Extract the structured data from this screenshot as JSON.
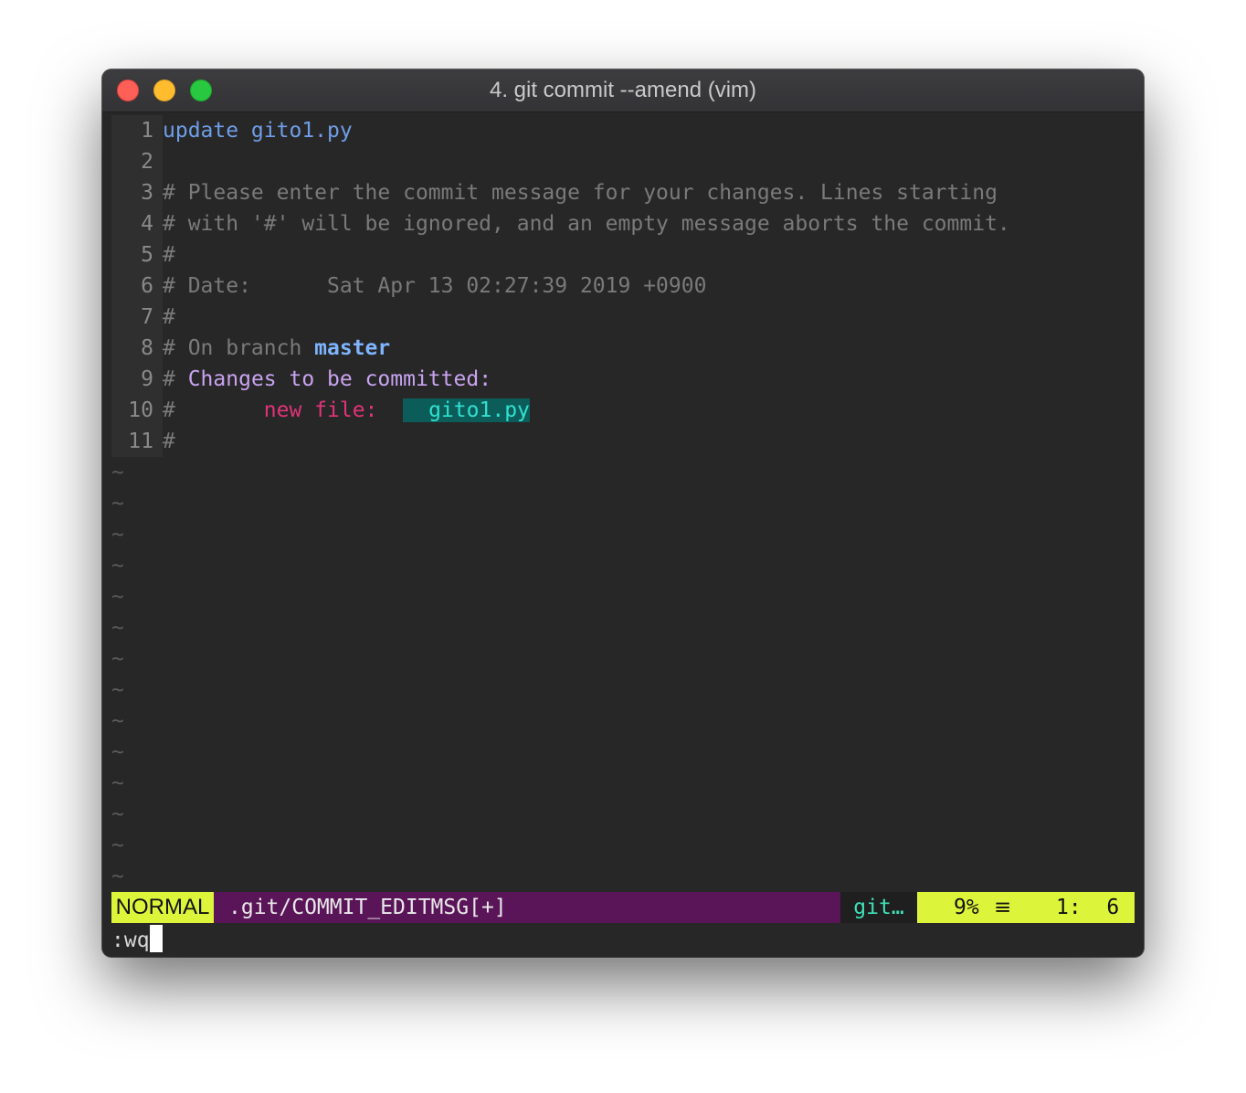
{
  "window": {
    "title": "4. git commit --amend (vim)"
  },
  "editor": {
    "lines": [
      {
        "num": "1",
        "text": "update gito1.py"
      },
      {
        "num": "2",
        "text": ""
      },
      {
        "num": "3",
        "text": "# Please enter the commit message for your changes. Lines starting"
      },
      {
        "num": "4",
        "text": "# with '#' will be ignored, and an empty message aborts the commit."
      },
      {
        "num": "5",
        "text": "#"
      },
      {
        "num": "6",
        "text": "# Date:      Sat Apr 13 02:27:39 2019 +0900"
      },
      {
        "num": "7",
        "text": "#"
      },
      {
        "num": "8",
        "prefix": "# On branch ",
        "branch": "master"
      },
      {
        "num": "9",
        "prefix": "# ",
        "header": "Changes to be committed:"
      },
      {
        "num": "10",
        "prefix": "#       ",
        "label": "new file:",
        "file": "gito1.py"
      },
      {
        "num": "11",
        "text": "#"
      }
    ],
    "tilde": "~"
  },
  "statusline": {
    "mode": "NORMAL",
    "file": ".git/COMMIT_EDITMSG[+]",
    "branch": "git…",
    "percent": "9%",
    "menu_glyph": "≡",
    "line_col": "1:  6"
  },
  "cmdline": {
    "text": ":wq"
  },
  "colors": {
    "mode_bg": "#dcf53a",
    "statusline_bg": "#5a1458",
    "branch_fg": "#3fe0b8",
    "new_file_fg": "#e0337a",
    "file_bg": "#0c5d5a"
  }
}
